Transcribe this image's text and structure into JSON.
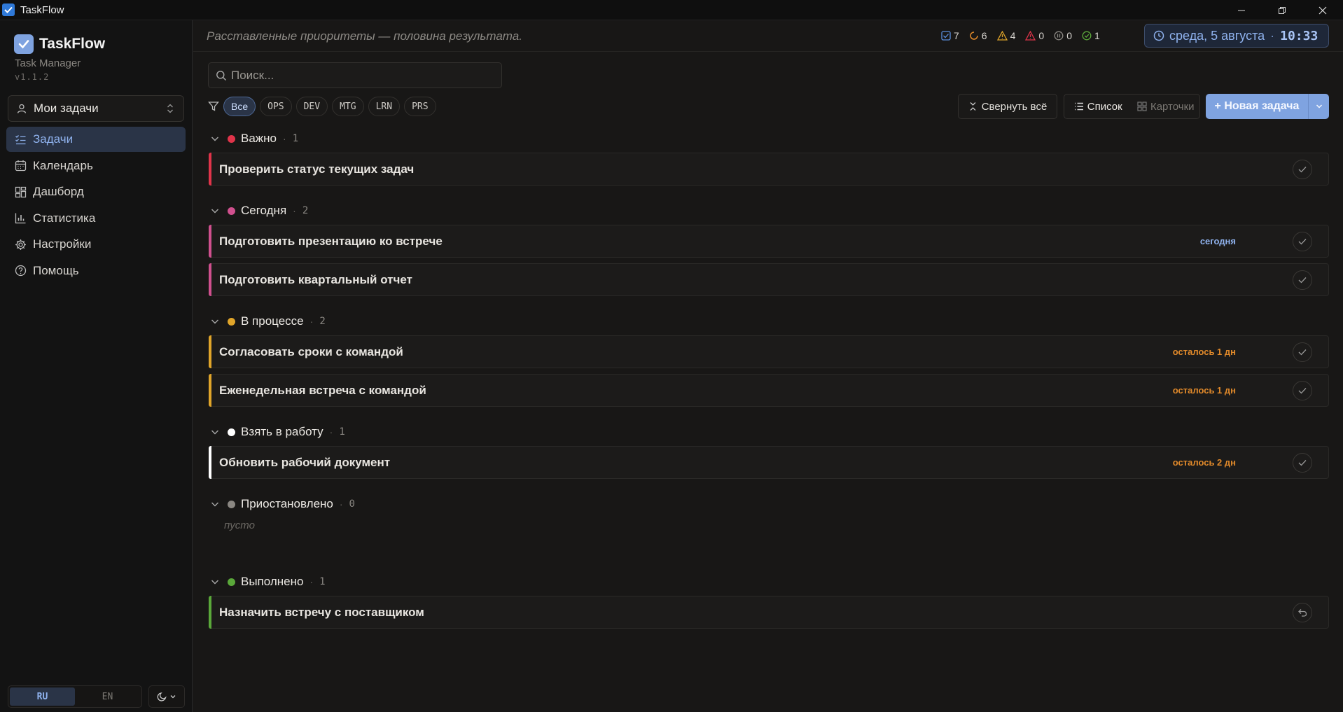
{
  "window": {
    "title": "TaskFlow"
  },
  "sidebar": {
    "brand": "TaskFlow",
    "subtitle": "Task Manager",
    "version": "v1.1.2",
    "scope": "Мои задачи",
    "items": [
      {
        "label": "Задачи",
        "icon": "checklist-icon",
        "active": true
      },
      {
        "label": "Календарь",
        "icon": "calendar-icon"
      },
      {
        "label": "Дашборд",
        "icon": "dashboard-icon"
      },
      {
        "label": "Статистика",
        "icon": "bar-chart-icon"
      },
      {
        "label": "Настройки",
        "icon": "gear-icon"
      },
      {
        "label": "Помощь",
        "icon": "help-icon"
      }
    ],
    "languages": [
      "RU",
      "EN"
    ],
    "active_language": "RU"
  },
  "header": {
    "quote": "Расставленные приоритеты — половина результата.",
    "stats": [
      {
        "icon": "checkbox-icon",
        "value": "7",
        "color": "#5b8fe0"
      },
      {
        "icon": "spinner-icon",
        "value": "6",
        "color": "#e0892a"
      },
      {
        "icon": "warning-icon",
        "value": "4",
        "color": "#e0a52a"
      },
      {
        "icon": "alert-icon",
        "value": "0",
        "color": "#e0344a"
      },
      {
        "icon": "pause-icon",
        "value": "0",
        "color": "#8a8782"
      },
      {
        "icon": "done-icon",
        "value": "1",
        "color": "#5aa83a"
      }
    ],
    "date": "среда, 5 августа",
    "separator": "·",
    "time": "10:33"
  },
  "toolbar": {
    "search_placeholder": "Поиск...",
    "filters": [
      "Все",
      "OPS",
      "DEV",
      "MTG",
      "LRN",
      "PRS"
    ],
    "collapse_label": "Свернуть всё",
    "view_list": "Список",
    "view_cards": "Карточки",
    "new_task": "+ Новая задача"
  },
  "groups": [
    {
      "name": "Важно",
      "count": "1",
      "color": "#e0344a",
      "tasks": [
        {
          "title": "Проверить статус текущих задач",
          "due": ""
        }
      ]
    },
    {
      "name": "Сегодня",
      "count": "2",
      "color": "#d0508e",
      "tasks": [
        {
          "title": "Подготовить презентацию ко встрече",
          "due": "сегодня",
          "due_color": "#8fb2ee"
        },
        {
          "title": "Подготовить квартальный отчет",
          "due": ""
        }
      ]
    },
    {
      "name": "В процессе",
      "count": "2",
      "color": "#e0a52a",
      "tasks": [
        {
          "title": "Согласовать сроки с командой",
          "due": "осталось 1 дн",
          "due_color": "#e0892a"
        },
        {
          "title": "Еженедельная встреча с командой",
          "due": "осталось 1 дн",
          "due_color": "#e0892a"
        }
      ]
    },
    {
      "name": "Взять в работу",
      "count": "1",
      "color": "#ffffff",
      "tasks": [
        {
          "title": "Обновить рабочий документ",
          "due": "осталось 2 дн",
          "due_color": "#e0892a"
        }
      ]
    },
    {
      "name": "Приостановлено",
      "count": "0",
      "color": "#8a8782",
      "tasks": [],
      "empty": "пусто"
    },
    {
      "name": "Выполнено",
      "count": "1",
      "color": "#5aa83a",
      "tasks": [
        {
          "title": "Назначить встречу с поставщиком",
          "due": "",
          "done": true
        }
      ]
    }
  ]
}
